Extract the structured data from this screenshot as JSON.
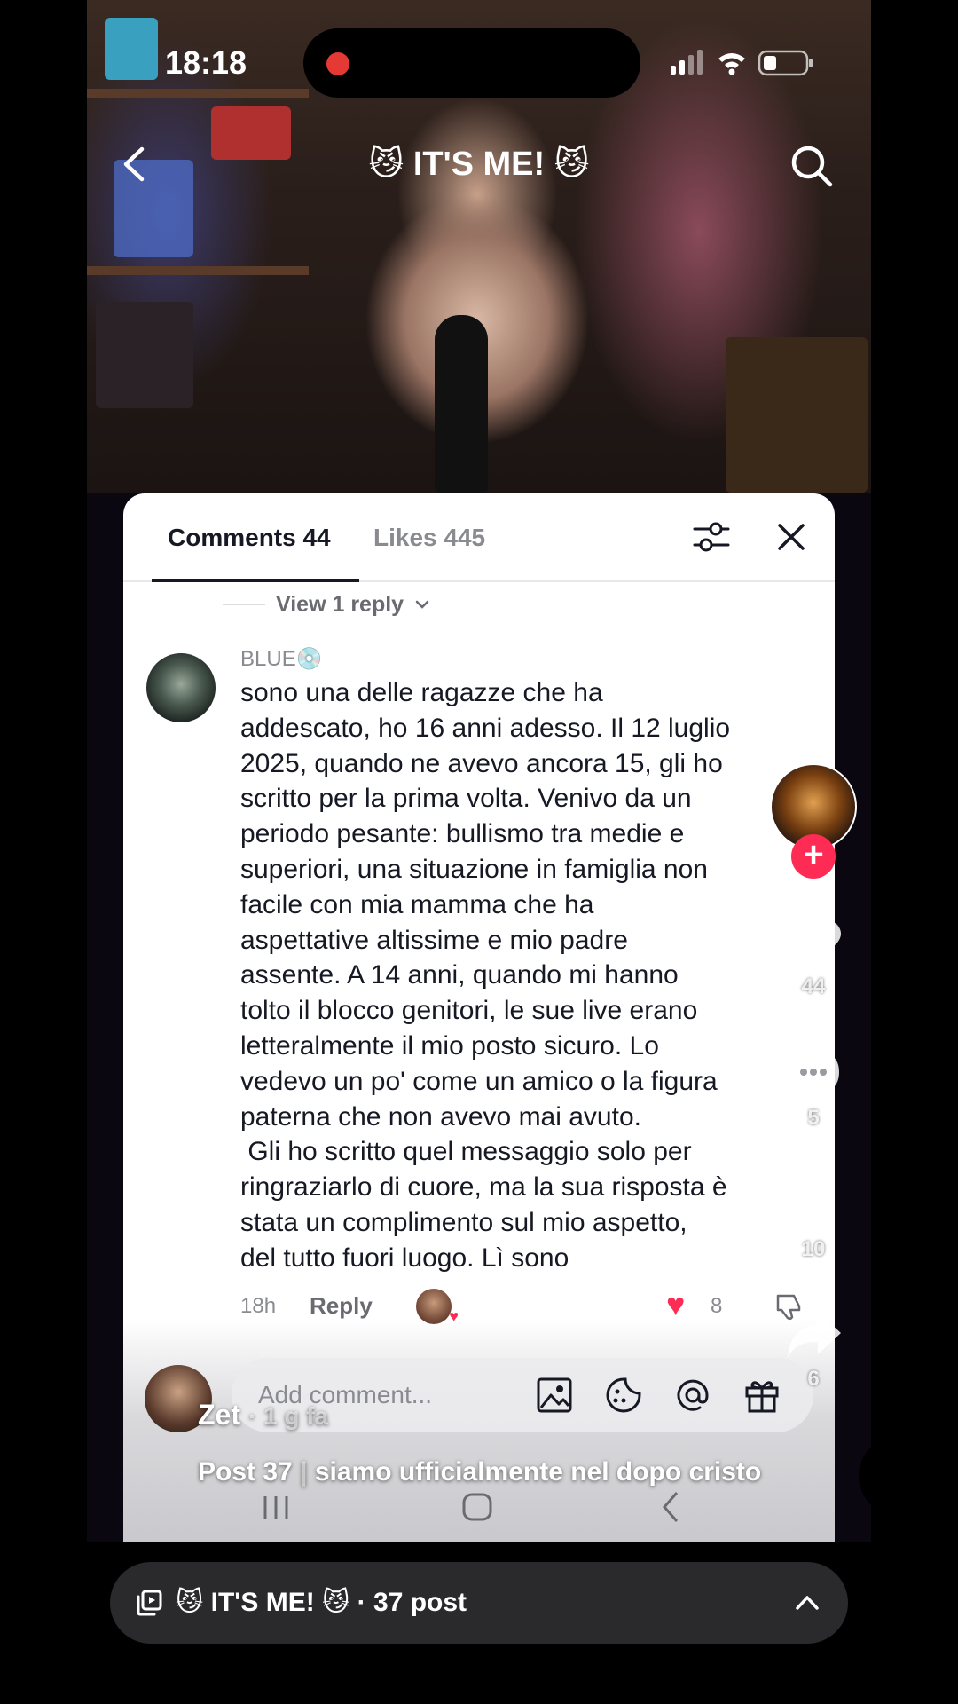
{
  "status_bar": {
    "time": "18:18"
  },
  "header": {
    "title": "😼 IT'S ME! 😼"
  },
  "comments_sheet": {
    "tabs": [
      {
        "label": "Comments 44"
      },
      {
        "label": "Likes 445"
      }
    ],
    "view_reply": "View 1 reply",
    "comment": {
      "username": "BLUE💿",
      "text": "sono una delle ragazze che ha\naddescato, ho 16 anni adesso. Il 12 luglio\n2025, quando ne avevo ancora 15, gli ho\nscritto per la prima volta. Venivo da un\nperiodo pesante: bullismo tra medie e\nsuperiori, una situazione in famiglia non\nfacile con mia mamma che ha\naspettative altissime e mio padre\nassente. A 14 anni, quando mi hanno\ntolto il blocco genitori, le sue live erano\nletteralmente il mio posto sicuro. Lo\nvedevo un po' come un amico o la figura\npaterna che non avevo mai avuto.\n Gli ho scritto quel messaggio solo per\nringraziarlo di cuore, ma la sua risposta è\nstata un complimento sul mio aspetto,\ndel tutto fuori luogo. Lì sono",
      "time": "18h",
      "reply_label": "Reply",
      "likes": "8"
    },
    "composer": {
      "placeholder": "Add comment..."
    }
  },
  "side_rail": {
    "likes": "44",
    "comments": "5",
    "saves": "10",
    "shares": "6"
  },
  "post": {
    "author": "Zet",
    "age": "· 1 g fa",
    "post_label": "Post 37",
    "separator": "|",
    "caption": "siamo ufficialmente nel dopo cristo"
  },
  "playlist": {
    "label": "😼 IT'S ME! 😼 · 37 post"
  },
  "colors": {
    "accent": "#fe2c55",
    "sheet": "#ffffff",
    "text": "#161823",
    "muted": "#8a8b91"
  },
  "icons": [
    "back-icon",
    "search-icon",
    "filter-icon",
    "close-icon",
    "chevron-down-icon",
    "heart-icon",
    "dislike-icon",
    "image-icon",
    "emoji-icon",
    "mention-icon",
    "gift-icon",
    "comment-icon",
    "bookmark-icon",
    "share-icon",
    "playlist-icon",
    "chevron-up-icon"
  ]
}
